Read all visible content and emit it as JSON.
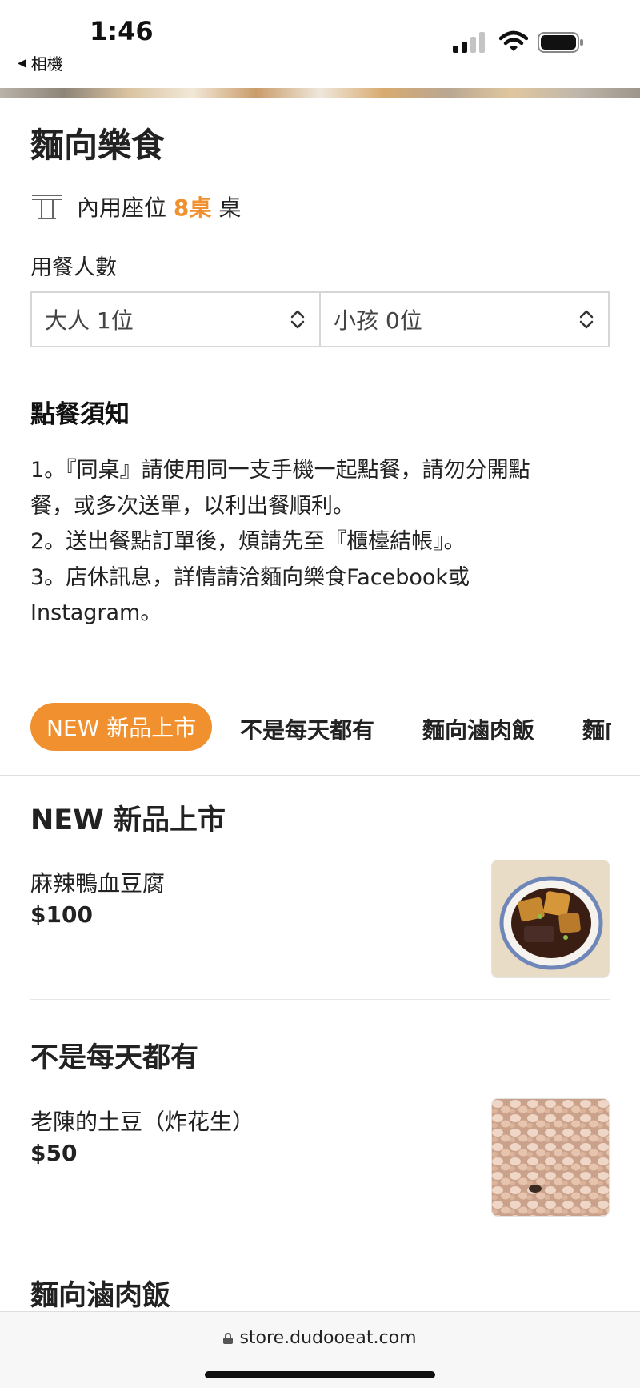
{
  "status_bar": {
    "time": "1:46",
    "back_label": "相機"
  },
  "store": {
    "name": "麵向樂食",
    "seat_prefix": "內用座位",
    "seat_number": "8桌",
    "seat_suffix": "桌"
  },
  "diners": {
    "label": "用餐人數",
    "adult": "大人 1位",
    "child": "小孩 0位"
  },
  "notice": {
    "title": "點餐須知",
    "lines": [
      "1。『同桌』請使用同一支手機一起點餐，請勿分開點",
      "餐，或多次送單，以利出餐順利。",
      "2。送出餐點訂單後，煩請先至『櫃檯結帳』。",
      "3。店休訊息，詳情請洽麵向樂食Facebook或",
      "Instagram。"
    ]
  },
  "tabs": [
    "NEW 新品上市",
    "不是每天都有",
    "麵向滷肉飯",
    "麵向"
  ],
  "sections": [
    {
      "heading": "NEW 新品上市",
      "item": {
        "name": "麻辣鴨血豆腐",
        "price": "$100",
        "photo_icon": "spicy-duck-blood-tofu-photo"
      }
    },
    {
      "heading": "不是每天都有",
      "item": {
        "name": "老陳的土豆（炸花生）",
        "price": "$50",
        "photo_icon": "fried-peanuts-photo"
      }
    },
    {
      "heading": "麵向滷肉飯"
    }
  ],
  "browser": {
    "url": "store.dudooeat.com"
  },
  "colors": {
    "accent": "#f0902e",
    "text": "#222222",
    "divider": "#e6e6e6"
  }
}
